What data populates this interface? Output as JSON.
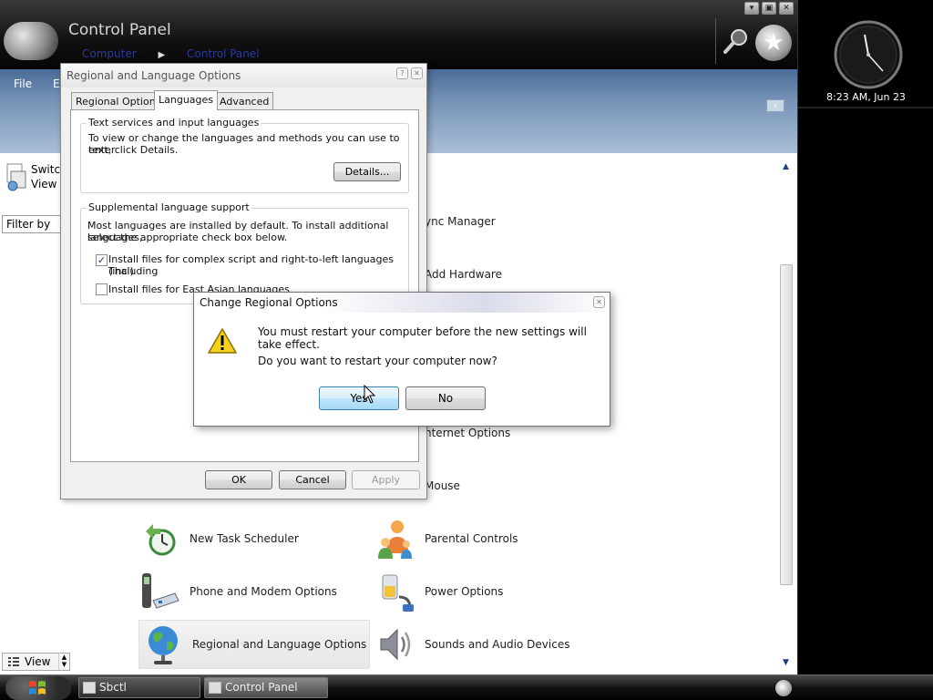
{
  "control_panel": {
    "title": "Control Panel",
    "breadcrumbs": [
      "Computer",
      "Control Panel"
    ],
    "menu": [
      "File",
      "E"
    ],
    "switch_view": [
      "Switch",
      "View"
    ],
    "filter_placeholder": "Filter by",
    "view_label": "View",
    "items": [
      {
        "label": "ync Manager"
      },
      {
        "label": "Add Hardware"
      },
      {
        "label": "nternet Options"
      },
      {
        "label": "Mouse"
      },
      {
        "label": "New Task Scheduler"
      },
      {
        "label": "Parental Controls"
      },
      {
        "label": "Phone and Modem Options"
      },
      {
        "label": "Power Options"
      },
      {
        "label": "Regional and Language Options"
      },
      {
        "label": "Sounds and Audio Devices"
      }
    ]
  },
  "sidebar": {
    "clock_text": "8:23 AM, Jun 23"
  },
  "taskbar": {
    "tasks": [
      "Sbctl",
      "Control Panel"
    ]
  },
  "regional_dialog": {
    "title": "Regional and Language Options",
    "tabs": [
      "Regional Options",
      "Languages",
      "Advanced"
    ],
    "active_tab": "Languages",
    "text_services": {
      "title": "Text services and input languages",
      "description_lines": [
        "To view or change the languages and methods you can use to enter",
        "text, click Details."
      ],
      "details_button": "Details..."
    },
    "supplemental": {
      "title": "Supplemental language support",
      "description_lines": [
        "Most languages are installed by default. To install additional languages,",
        "select the appropriate check box below."
      ],
      "complex_script": {
        "lines": [
          "Install files for complex script and right-to-left languages (including",
          "Thai)"
        ],
        "checked": true
      },
      "east_asian": {
        "label": "Install files for East Asian languages",
        "checked": false
      }
    },
    "buttons": {
      "ok": "OK",
      "cancel": "Cancel",
      "apply": "Apply"
    }
  },
  "change_dialog": {
    "title": "Change Regional Options",
    "message": "You must restart your computer before the new settings will take effect.",
    "question": "Do you want to restart your computer now?",
    "yes": "Yes",
    "no": "No"
  },
  "colors": {
    "menubar": "#7491b5",
    "dialog_bg": "#f0f0f0",
    "default_button": "#bee6fd"
  }
}
